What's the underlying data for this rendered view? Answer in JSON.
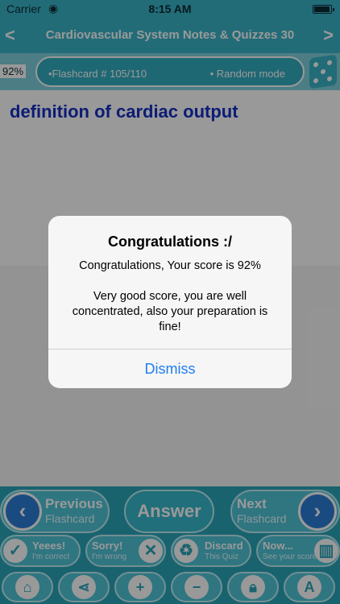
{
  "status": {
    "carrier": "Carrier",
    "time": "8:15 AM"
  },
  "nav": {
    "title": "Cardiovascular System Notes & Quizzes 30",
    "prev": "<",
    "next": ">"
  },
  "info": {
    "score": "92%",
    "flashcard": "•Flashcard # 105/110",
    "mode": "• Random mode"
  },
  "card": {
    "question": "definition of cardiac output"
  },
  "buttons": {
    "previous_l1": "Previous",
    "previous_l2": "Flashcard",
    "answer": "Answer",
    "next_l1": "Next",
    "next_l2": "Flashcard",
    "yes_l1": "Yeees!",
    "yes_l2": "I'm correct",
    "sorry_l1": "Sorry!",
    "sorry_l2": "I'm wrong",
    "discard_l1": "Discard",
    "discard_l2": "This Quiz",
    "now_l1": "Now...",
    "now_l2": "See your score"
  },
  "bottom_icons": [
    "home-icon",
    "share-icon",
    "zoom-in-icon",
    "zoom-out-icon",
    "lock-icon",
    "font-icon"
  ],
  "alert": {
    "title": "Congratulations :/",
    "message_line1": "Congratulations, Your score is 92%",
    "message_line2": "Very good score, you are well concentrated, also your preparation is fine!",
    "dismiss": "Dismiss"
  },
  "colors": {
    "accent": "#39b5c9",
    "question": "#1430c4",
    "link": "#1f7ef0"
  }
}
